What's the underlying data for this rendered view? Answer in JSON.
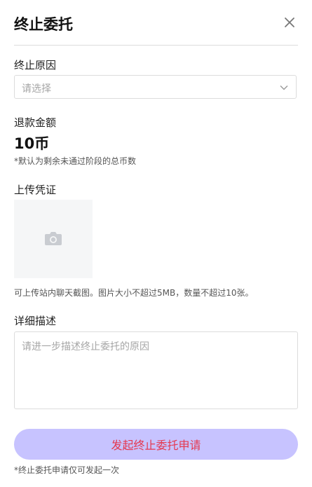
{
  "header": {
    "title": "终止委托",
    "close_icon": "close-icon"
  },
  "reason": {
    "label": "终止原因",
    "placeholder": "请选择",
    "chevron_icon": "chevron-down-icon"
  },
  "refund": {
    "label": "退款金额",
    "amount": "10币",
    "note": "*默认为剩余未通过阶段的总币数"
  },
  "proof": {
    "label": "上传凭证",
    "upload_icon": "camera-icon",
    "hint": "可上传站内聊天截图。图片大小不超过5MB，数量不超过10张。"
  },
  "details": {
    "label": "详细描述",
    "placeholder": "请进一步描述终止委托的原因"
  },
  "submit": {
    "label": "发起终止委托申请",
    "note": "*终止委托申请仅可发起一次"
  },
  "colors": {
    "button_bg": "#c7c3ff",
    "button_text": "#e5394f",
    "border": "#dcdcdc",
    "placeholder": "#a6a6a6",
    "upload_bg": "#f5f6f7"
  }
}
